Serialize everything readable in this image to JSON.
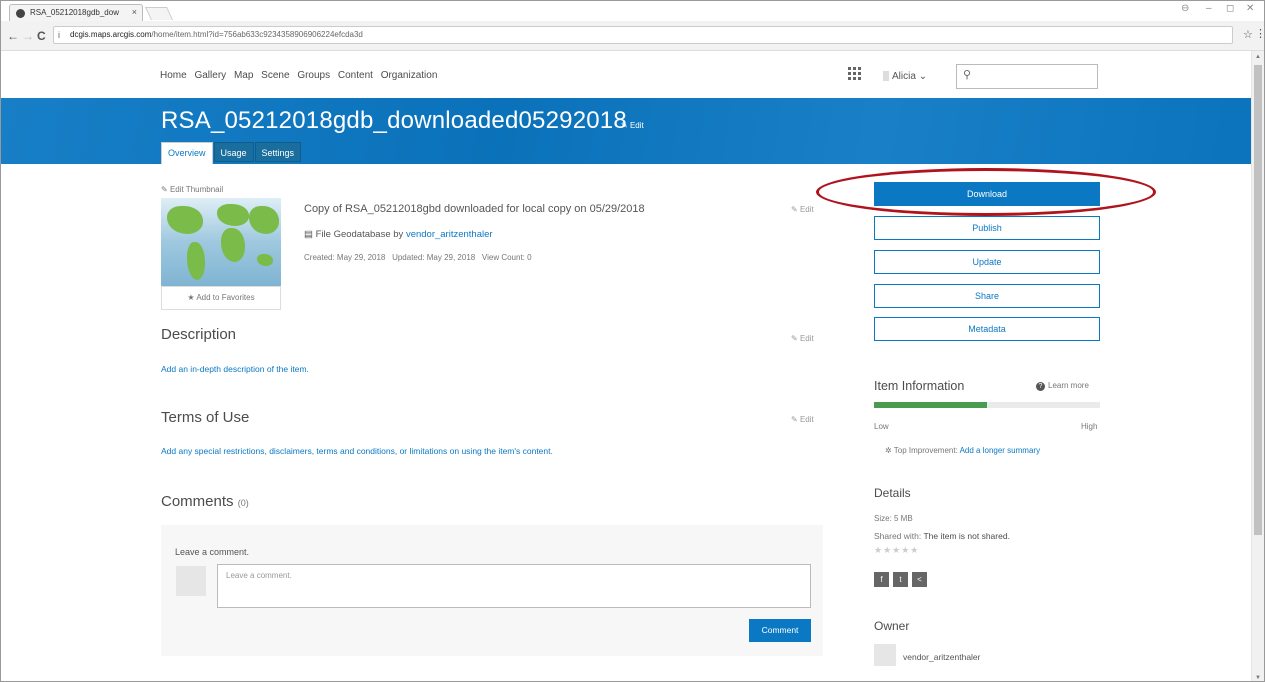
{
  "browser": {
    "tab_title": "RSA_05212018gdb_dow",
    "tab_close": "×",
    "url_host": "dcgis.maps.arcgis.com",
    "url_path": "/home/item.html?id=756ab633c9234358906906224efcda3d",
    "info_icon": "i",
    "back": "←",
    "forward": "→",
    "reload": "C",
    "bookmark": "☆",
    "menu": "⋮",
    "profile": "⊖",
    "minimize": "–",
    "restore": "◻",
    "close": "✕"
  },
  "topnav": {
    "links": [
      "Home",
      "Gallery",
      "Map",
      "Scene",
      "Groups",
      "Content",
      "Organization"
    ],
    "user_name": "Alicia",
    "user_caret": "⌄",
    "search_icon": "⚲",
    "search_placeholder": ""
  },
  "banner": {
    "title": "RSA_05212018gdb_downloaded05292018",
    "edit_label": "Edit",
    "tabs": [
      "Overview",
      "Usage",
      "Settings"
    ]
  },
  "item": {
    "edit_thumbnail": "Edit Thumbnail",
    "add_favorites": "Add to Favorites",
    "summary": "Copy of RSA_05212018gbd downloaded for local copy on 05/29/2018",
    "summary_edit": "Edit",
    "file_type": "File Geodatabase by",
    "owner_link": "vendor_aritzenthaler",
    "created": "Created: May 29, 2018",
    "updated": "Updated: May 29, 2018",
    "view_count": "View Count: 0"
  },
  "description": {
    "heading": "Description",
    "edit": "Edit",
    "link": "Add an in-depth description of the item."
  },
  "terms": {
    "heading": "Terms of Use",
    "edit": "Edit",
    "link": "Add any special restrictions, disclaimers, terms and conditions, or limitations on using the item's content."
  },
  "comments": {
    "heading": "Comments",
    "count": "(0)",
    "leave_label": "Leave a comment.",
    "placeholder": "Leave a comment.",
    "button": "Comment"
  },
  "actions": {
    "download": "Download",
    "publish": "Publish",
    "update": "Update",
    "share": "Share",
    "metadata": "Metadata"
  },
  "item_information": {
    "heading": "Item Information",
    "learn_more": "Learn more",
    "low": "Low",
    "high": "High",
    "meter_fraction": 0.5,
    "top_improvement_label": "Top Improvement:",
    "top_improvement_link": "Add a longer summary"
  },
  "details": {
    "heading": "Details",
    "size": "Size: 5 MB",
    "shared_label": "Shared with:",
    "shared_value": "The item is not shared.",
    "rating": "★★★★★"
  },
  "social": [
    "f",
    "t",
    "<"
  ],
  "owner": {
    "heading": "Owner",
    "name": "vendor_aritzenthaler"
  },
  "colors": {
    "accent": "#0b78c4",
    "highlight_ring": "#b0131b",
    "meter_fill": "#4a9a50"
  }
}
